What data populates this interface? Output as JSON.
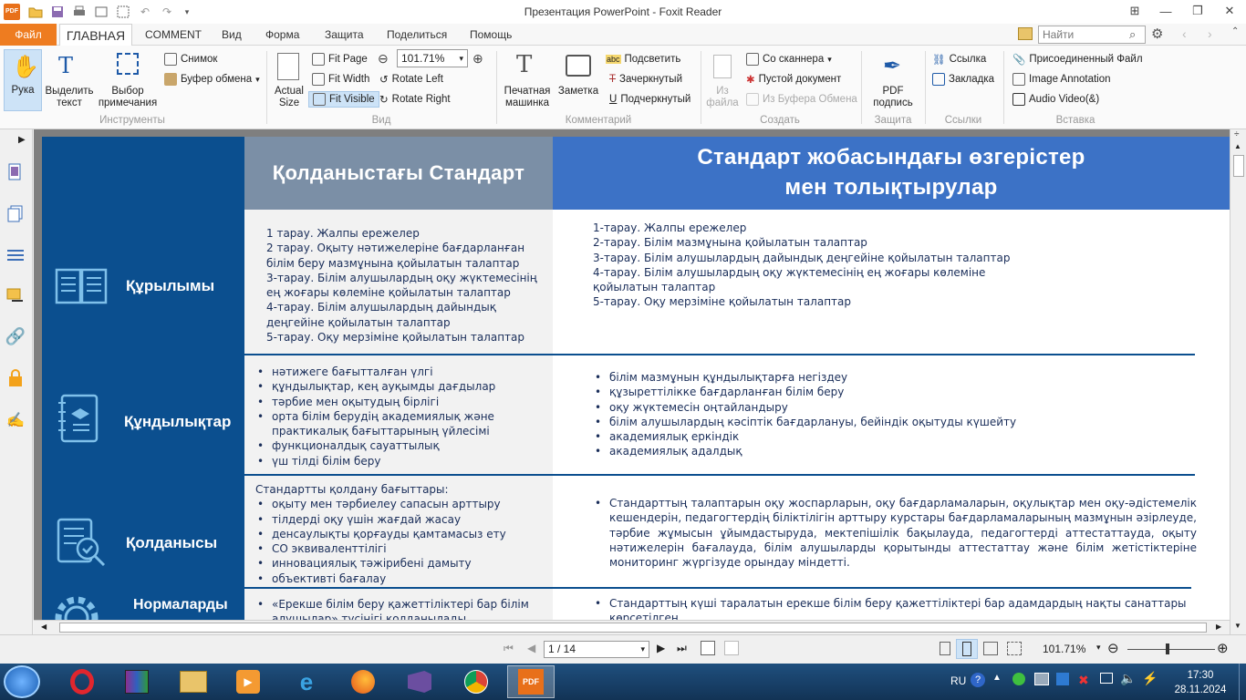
{
  "window": {
    "title": "Презентация PowerPoint - Foxit Reader"
  },
  "tabs": {
    "file": "Файл",
    "home": "ГЛАВНАЯ",
    "comment": "COMMENT",
    "view": "Вид",
    "form": "Форма",
    "protect": "Защита",
    "share": "Поделиться",
    "help": "Помощь"
  },
  "search": {
    "placeholder": "Найти"
  },
  "ribbon": {
    "hand": "Рука",
    "select_text": "Выделить текст",
    "select_annot": "Выбор примечания",
    "snapshot": "Снимок",
    "clipboard": "Буфер обмена",
    "tools_group": "Инструменты",
    "actual_size": "Actual Size",
    "fit_page": "Fit Page",
    "fit_width": "Fit Width",
    "fit_visible": "Fit Visible",
    "zoom_value": "101.71%",
    "rotate_left": "Rotate Left",
    "rotate_right": "Rotate Right",
    "view_group": "Вид",
    "typewriter": "Печатная машинка",
    "note": "Заметка",
    "highlight": "Подсветить",
    "strikeout": "Зачеркнутый",
    "underline": "Подчеркнутый",
    "comment_group": "Комментарий",
    "from_file": "Из файла",
    "from_scanner": "Со сканнера",
    "blank_doc": "Пустой документ",
    "from_clipboard": "Из Буфера Обмена",
    "create_group": "Создать",
    "pdf_sign": "PDF подпись",
    "protect_group": "Защита",
    "link": "Ссылка",
    "bookmark": "Закладка",
    "links_group": "Ссылки",
    "attach_file": "Присоединенный Файл",
    "image_annot": "Image Annotation",
    "audio_video": "Audio  Video(&)",
    "insert_group": "Вставка"
  },
  "slide": {
    "head_current": "Қолданыстағы Стандарт",
    "head_changes_line1": "Стандарт жобасындағы өзгерістер",
    "head_changes_line2": "мен толықтырулар",
    "sections": [
      {
        "label": "Құрылымы",
        "current": [
          "1 тарау. Жалпы ережелер",
          "2 тарау. Оқыту нәтижелеріне бағдарланған білім беру мазмұнына қойылатын талаптар",
          "3-тарау. Білім алушылардың оқу жүктемесінің ең жоғары көлеміне қойылатын талаптар",
          "4-тарау. Білім алушылардың дайындық деңгейіне қойылатын талаптар",
          "5-тарау. Оқу мерзіміне қойылатын талаптар"
        ],
        "changes": [
          "1-тарау. Жалпы ережелер",
          "2-тарау. Білім мазмұнына қойылатын талаптар",
          "3-тарау. Білім алушылардың дайындық деңгейіне қойылатын талаптар",
          "4-тарау. Білім алушылардың оқу жүктемесінің ең жоғары көлеміне қойылатын талаптар",
          "5-тарау. Оқу мерзіміне қойылатын талаптар"
        ]
      },
      {
        "label": "Құндылықтар",
        "current": [
          "нәтижеге бағытталған үлгі",
          "құндылықтар, кең ауқымды дағдылар",
          "тәрбие мен оқытудың бірлігі",
          "орта білім берудің академиялық және практикалық бағыттарының үйлесімі",
          "функционалдық сауаттылық",
          "үш тілді білім беру"
        ],
        "changes": [
          "білім мазмұнын құндылықтарға негіздеу",
          "құзыреттілікке бағдарланған білім беру",
          "оқу жүктемесін оңтайландыру",
          "білім алушылардың кәсіптік бағдарлануы, бейіндік оқытуды күшейту",
          "академиялық еркіндік",
          "академиялық адалдық"
        ]
      },
      {
        "label": "Қолданысы",
        "current_intro": "Стандартты қолдану бағыттары:",
        "current": [
          "оқыту мен тәрбиелеу сапасын арттыру",
          "тілдерді оқу үшін жағдай жасау",
          "денсаулықты қорғауды қамтамасыз ету",
          "СО эквиваленттілігі",
          "инновациялық тәжірибені дамыту",
          "объективті бағалау"
        ],
        "changes": [
          "Стандарттың талаптарын оқу жоспарларын, оқу бағдарламаларын, оқулықтар мен оқу-әдістемелік кешендерін, педагогтердің біліктілігін арттыру курстары бағдарламаларының мазмұнын әзірлеуде, тәрбие жұмысын ұйымдастыруда, мектепішілік бақылауда, педагогтерді аттестаттауда, оқыту нәтижелерін бағалауда, білім алушыларды қорытынды аттестаттау және білім жетістіктеріне мониторинг жүргізуде орындау міндетті."
        ]
      },
      {
        "label": "Нормаларды",
        "current": [
          "«Ерекше білім беру қажеттіліктері бар білім алушылар» түсінігі қолданылады"
        ],
        "changes": [
          "Стандарттың күші таралатын ерекше білім беру қажеттіліктері бар адамдардың нақты санаттары көрсетілген"
        ]
      }
    ]
  },
  "statusbar": {
    "page": "1 / 14",
    "zoom": "101.71%"
  },
  "taskbar": {
    "lang": "RU",
    "time": "17:30",
    "date": "28.11.2024"
  },
  "colors": {
    "accent": "#ee7c20",
    "slide_blue": "#0b4f8f",
    "header_blue": "#3c72c6",
    "header_gray": "#7b8fa6"
  }
}
